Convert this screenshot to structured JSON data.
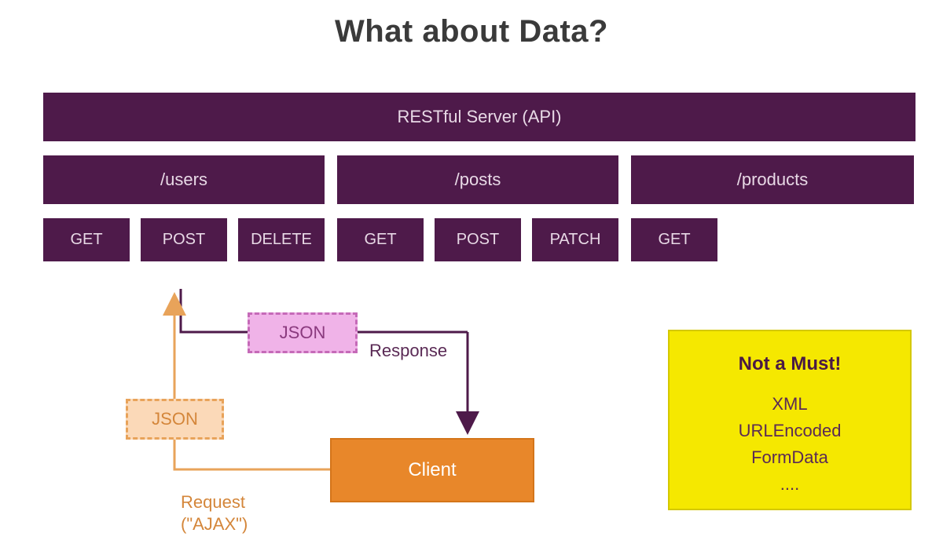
{
  "title": "What about Data?",
  "server": "RESTful Server (API)",
  "routes": {
    "users": "/users",
    "posts": "/posts",
    "products": "/products"
  },
  "methods": {
    "users": [
      "GET",
      "POST",
      "DELETE"
    ],
    "posts": [
      "GET",
      "POST",
      "PATCH"
    ],
    "products": [
      "GET"
    ]
  },
  "response_format": "JSON",
  "response_label": "Response",
  "request_format": "JSON",
  "request_label_line1": "Request",
  "request_label_line2": "(\"AJAX\")",
  "client_label": "Client",
  "note": {
    "title": "Not a Must!",
    "items": [
      "XML",
      "URLEncoded",
      "FormData",
      "...."
    ]
  },
  "colors": {
    "purple": "#4e1a4a",
    "orange": "#e8872a",
    "request_orange": "#d4863a",
    "response_pink": "#c56ab8",
    "note_yellow": "#f5e800"
  }
}
